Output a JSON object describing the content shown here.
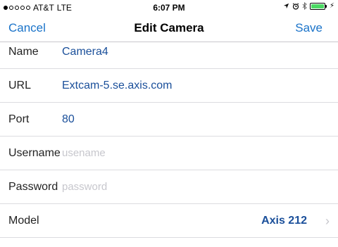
{
  "status": {
    "carrier": "AT&T",
    "network": "LTE",
    "time": "6:07 PM",
    "location_icon": "location-arrow-icon",
    "alarm_icon": "alarm-clock-icon",
    "bluetooth_icon": "bluetooth-icon",
    "battery_color": "#4cd964"
  },
  "nav": {
    "cancel": "Cancel",
    "title": "Edit Camera",
    "save": "Save"
  },
  "form": {
    "name_label": "Name",
    "name_value": "Camera4",
    "url_label": "URL",
    "url_value": "Extcam-5.se.axis.com",
    "port_label": "Port",
    "port_value": "80",
    "username_label": "Username",
    "username_placeholder": "usename",
    "password_label": "Password",
    "password_placeholder": "password",
    "model_label": "Model",
    "model_value": "Axis 212"
  },
  "colors": {
    "accent": "#1a73c9",
    "value_text": "#1a4f9a"
  }
}
